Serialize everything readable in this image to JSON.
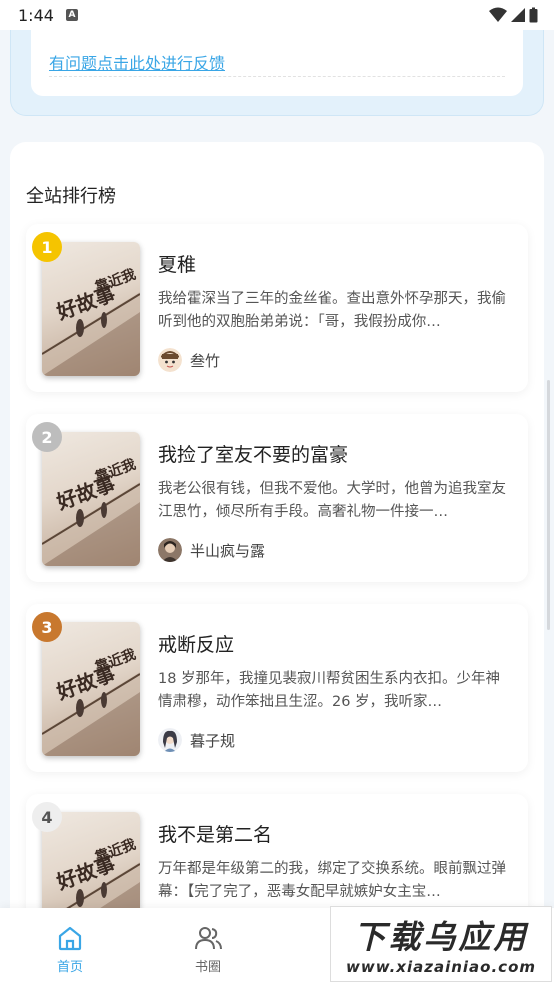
{
  "status": {
    "time": "1:44",
    "a_label": "A"
  },
  "feedback": {
    "link_text": "有问题点击此处进行反馈"
  },
  "ranking": {
    "title": "全站排行榜",
    "books": [
      {
        "rank": "1",
        "badge_color": "#f5c400",
        "title": "夏稚",
        "desc": "我给霍深当了三年的金丝雀。查出意外怀孕那天，我偷听到他的双胞胎弟弟说：「哥，我假扮成你…",
        "author": "叁竹",
        "avatar_icon": "cartoon-avatar-icon"
      },
      {
        "rank": "2",
        "badge_color": "#bdbdbd",
        "title": "我捡了室友不要的富豪",
        "desc": "我老公很有钱，但我不爱他。大学时，他曾为追我室友江思竹，倾尽所有手段。高奢礼物一件接一…",
        "author": "半山疯与露",
        "avatar_icon": "photo-avatar-icon"
      },
      {
        "rank": "3",
        "badge_color": "#c8782e",
        "title": "戒断反应",
        "desc": "18 岁那年，我撞见裴寂川帮贫困生系内衣扣。少年神情肃穆，动作笨拙且生涩。26 岁，我听家…",
        "author": "暮子规",
        "avatar_icon": "illustrated-avatar-icon"
      },
      {
        "rank": "4",
        "badge_color": "#eeeeee",
        "title": "我不是第二名",
        "desc": "万年都是年级第二的我，绑定了交换系统。眼前飘过弹幕：【完了完了，恶毒女配早就嫉妒女主宝…",
        "author": "",
        "avatar_icon": ""
      }
    ],
    "cover_text": "好故事 靠近我"
  },
  "nav": {
    "home_label": "首页",
    "circle_label": "书圈",
    "active_color": "#3aa6e6"
  },
  "watermark": {
    "top": "下载乌应用",
    "bottom": "www.xiazainiao.com"
  }
}
